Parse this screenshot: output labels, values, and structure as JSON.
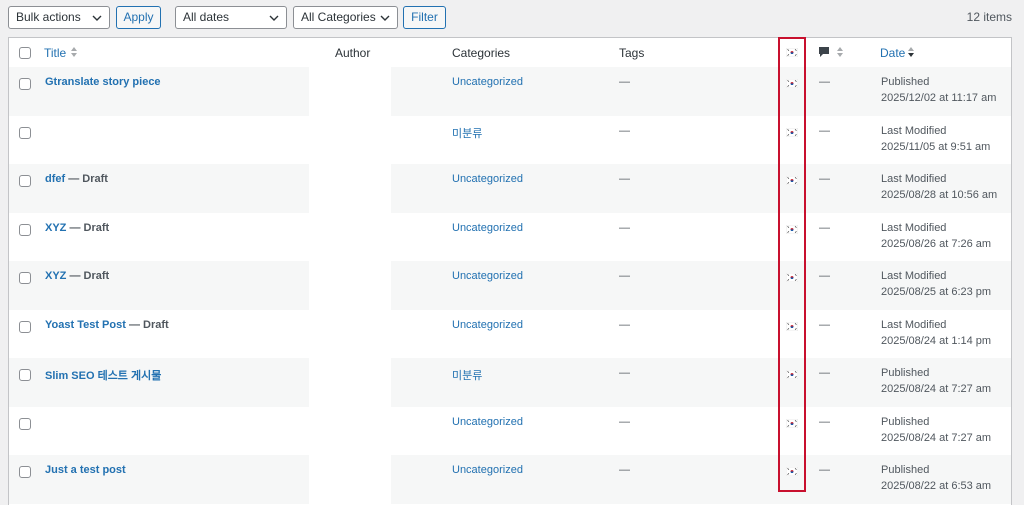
{
  "toolbar": {
    "bulk_actions": "Bulk actions",
    "apply": "Apply",
    "dates": "All dates",
    "categories": "All Categories",
    "filter": "Filter",
    "items_count": "12 items"
  },
  "columns": {
    "title": "Title",
    "author": "Author",
    "categories": "Categories",
    "tags": "Tags",
    "language_icon": "korean-flag-icon",
    "comments_icon": "comment-icon",
    "date": "Date"
  },
  "rows": [
    {
      "title": "Gtranslate story piece",
      "draft": "",
      "category": "Uncategorized",
      "tags": "—",
      "comments": "—",
      "status": "Published",
      "date": "2025/12/02 at 11:17 am"
    },
    {
      "title": "",
      "draft": "",
      "category": "미분류",
      "tags": "—",
      "comments": "—",
      "status": "Last Modified",
      "date": "2025/11/05 at 9:51 am"
    },
    {
      "title": "dfef",
      "draft": " — Draft",
      "category": "Uncategorized",
      "tags": "—",
      "comments": "—",
      "status": "Last Modified",
      "date": "2025/08/28 at 10:56 am"
    },
    {
      "title": "XYZ",
      "draft": " — Draft",
      "category": "Uncategorized",
      "tags": "—",
      "comments": "—",
      "status": "Last Modified",
      "date": "2025/08/26 at 7:26 am"
    },
    {
      "title": "XYZ",
      "draft": " — Draft",
      "category": "Uncategorized",
      "tags": "—",
      "comments": "—",
      "status": "Last Modified",
      "date": "2025/08/25 at 6:23 pm"
    },
    {
      "title": "Yoast Test Post",
      "draft": " — Draft",
      "category": "Uncategorized",
      "tags": "—",
      "comments": "—",
      "status": "Last Modified",
      "date": "2025/08/24 at 1:14 pm"
    },
    {
      "title": "Slim SEO 테스트 게시물",
      "draft": "",
      "category": "미분류",
      "tags": "—",
      "comments": "—",
      "status": "Published",
      "date": "2025/08/24 at 7:27 am"
    },
    {
      "title": "",
      "draft": "",
      "category": "Uncategorized",
      "tags": "—",
      "comments": "—",
      "status": "Published",
      "date": "2025/08/24 at 7:27 am"
    },
    {
      "title": "Just a test post",
      "draft": "",
      "category": "Uncategorized",
      "tags": "—",
      "comments": "—",
      "status": "Published",
      "date": "2025/08/22 at 6:53 am"
    }
  ],
  "colors": {
    "link": "#2271b1",
    "highlight": "#c8102e",
    "row_alt": "#f6f7f7"
  }
}
